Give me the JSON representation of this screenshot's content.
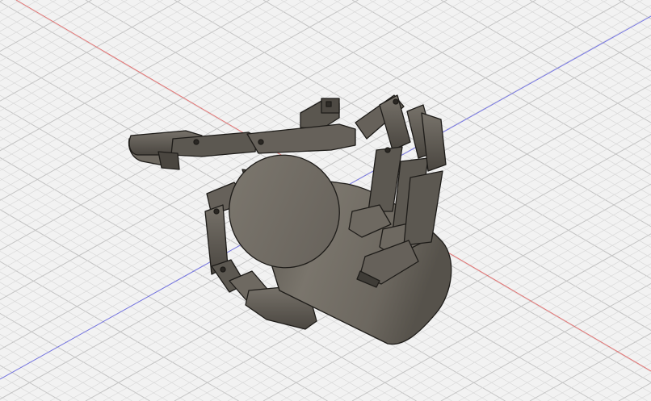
{
  "viewport": {
    "background_color": "#f2f2f2",
    "grid_minor_color": "#d9d9d9",
    "grid_major_color": "#c4c4c4",
    "axis_x_color": "#e05555",
    "axis_y_color": "#5a5ae0"
  },
  "model": {
    "metal_dark": "#3f3c37",
    "metal_mid": "#5e5a53",
    "metal_light": "#8a857c",
    "cylinder_top": "#7a756c",
    "cylinder_side": "#6b665e",
    "edge_color": "#1e1c19"
  }
}
